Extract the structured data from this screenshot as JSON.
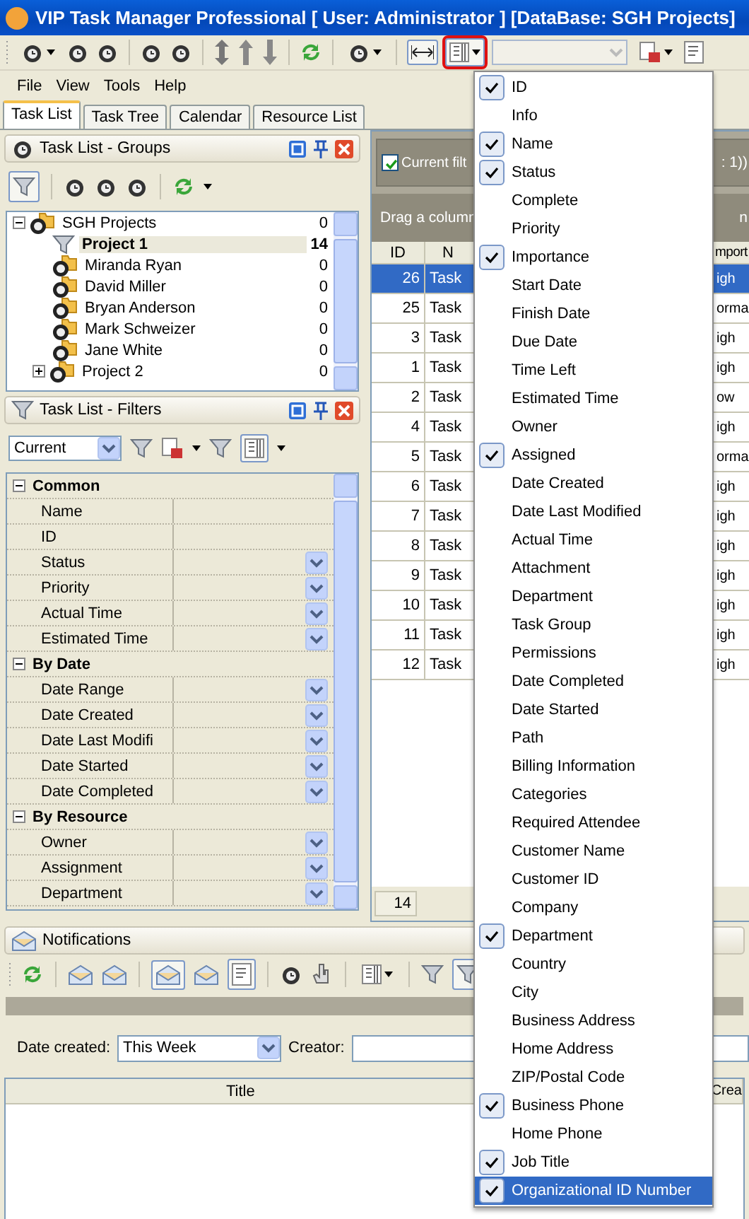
{
  "window": {
    "title": "VIP Task Manager Professional [ User: Administrator ] [DataBase: SGH Projects]"
  },
  "toolbar": {
    "column_button_highlighted": true
  },
  "menu_bar": [
    "File",
    "View",
    "Tools",
    "Help"
  ],
  "tabs": [
    {
      "label": "Task List",
      "selected": true
    },
    {
      "label": "Task Tree",
      "selected": false
    },
    {
      "label": "Calendar",
      "selected": false
    },
    {
      "label": "Resource List",
      "selected": false
    }
  ],
  "groups_panel": {
    "title": "Task List - Groups",
    "tree": [
      {
        "label": "SGH Projects",
        "count": "0",
        "expanded": true,
        "selected": false,
        "kind": "group",
        "children": [
          {
            "label": "Project 1",
            "count": "14",
            "selected": true,
            "kind": "filter"
          },
          {
            "label": "Miranda Ryan",
            "count": "0",
            "selected": false,
            "kind": "group"
          },
          {
            "label": "David Miller",
            "count": "0",
            "selected": false,
            "kind": "group"
          },
          {
            "label": "Bryan Anderson",
            "count": "0",
            "selected": false,
            "kind": "group"
          },
          {
            "label": "Mark Schweizer",
            "count": "0",
            "selected": false,
            "kind": "group"
          },
          {
            "label": "Jane White",
            "count": "0",
            "selected": false,
            "kind": "group"
          },
          {
            "label": "Project 2",
            "count": "0",
            "selected": false,
            "expanded": false,
            "kind": "group"
          }
        ]
      }
    ]
  },
  "filters_panel": {
    "title": "Task List - Filters",
    "preset": "Current",
    "sections": [
      {
        "title": "Common",
        "expanded": true,
        "fields": [
          {
            "label": "Name",
            "dropdown": false
          },
          {
            "label": "ID",
            "dropdown": false
          },
          {
            "label": "Status",
            "dropdown": true
          },
          {
            "label": "Priority",
            "dropdown": true
          },
          {
            "label": "Actual Time",
            "dropdown": true
          },
          {
            "label": "Estimated Time",
            "dropdown": true
          }
        ]
      },
      {
        "title": "By Date",
        "expanded": true,
        "fields": [
          {
            "label": "Date Range",
            "dropdown": true
          },
          {
            "label": "Date Created",
            "dropdown": true
          },
          {
            "label": "Date Last Modifi",
            "dropdown": true
          },
          {
            "label": "Date Started",
            "dropdown": true
          },
          {
            "label": "Date Completed",
            "dropdown": true
          }
        ]
      },
      {
        "title": "By Resource",
        "expanded": true,
        "fields": [
          {
            "label": "Owner",
            "dropdown": true
          },
          {
            "label": "Assignment",
            "dropdown": true
          },
          {
            "label": "Department",
            "dropdown": true
          }
        ]
      }
    ]
  },
  "task_grid": {
    "current_filter": {
      "checked": true,
      "label": "Current filt",
      "tail": ": 1))"
    },
    "group_hint": {
      "label": "Drag a column",
      "tail": "n"
    },
    "columns": [
      "ID",
      "N",
      "mport"
    ],
    "rows": [
      {
        "id": "26",
        "name": "Task",
        "column_3": "igh",
        "selected": true
      },
      {
        "id": "25",
        "name": "Task",
        "column_3": "orma",
        "selected": false
      },
      {
        "id": "3",
        "name": "Task",
        "column_3": "igh",
        "selected": false
      },
      {
        "id": "1",
        "name": "Task",
        "column_3": "igh",
        "selected": false
      },
      {
        "id": "2",
        "name": "Task",
        "column_3": "ow",
        "selected": false
      },
      {
        "id": "4",
        "name": "Task",
        "column_3": "igh",
        "selected": false
      },
      {
        "id": "5",
        "name": "Task",
        "column_3": "orma",
        "selected": false
      },
      {
        "id": "6",
        "name": "Task",
        "column_3": "igh",
        "selected": false
      },
      {
        "id": "7",
        "name": "Task",
        "column_3": "igh",
        "selected": false
      },
      {
        "id": "8",
        "name": "Task",
        "column_3": "igh",
        "selected": false
      },
      {
        "id": "9",
        "name": "Task",
        "column_3": "igh",
        "selected": false
      },
      {
        "id": "10",
        "name": "Task",
        "column_3": "igh",
        "selected": false
      },
      {
        "id": "11",
        "name": "Task",
        "column_3": "igh",
        "selected": false
      },
      {
        "id": "12",
        "name": "Task",
        "column_3": "igh",
        "selected": false
      }
    ],
    "footer_count": "14"
  },
  "notifications": {
    "title": "Notifications",
    "date_created_label": "Date created:",
    "date_created_value": "This Week",
    "creator_label": "Creator:",
    "columns": [
      "Title",
      "Crea"
    ]
  },
  "column_menu": [
    {
      "label": "ID",
      "checked": true,
      "selected": false
    },
    {
      "label": "Info",
      "checked": false,
      "selected": false
    },
    {
      "label": "Name",
      "checked": true,
      "selected": false
    },
    {
      "label": "Status",
      "checked": true,
      "selected": false
    },
    {
      "label": "Complete",
      "checked": false,
      "selected": false
    },
    {
      "label": "Priority",
      "checked": false,
      "selected": false
    },
    {
      "label": "Importance",
      "checked": true,
      "selected": false
    },
    {
      "label": "Start Date",
      "checked": false,
      "selected": false
    },
    {
      "label": "Finish Date",
      "checked": false,
      "selected": false
    },
    {
      "label": "Due Date",
      "checked": false,
      "selected": false
    },
    {
      "label": "Time Left",
      "checked": false,
      "selected": false
    },
    {
      "label": "Estimated Time",
      "checked": false,
      "selected": false
    },
    {
      "label": "Owner",
      "checked": false,
      "selected": false
    },
    {
      "label": "Assigned",
      "checked": true,
      "selected": false
    },
    {
      "label": "Date Created",
      "checked": false,
      "selected": false
    },
    {
      "label": "Date Last Modified",
      "checked": false,
      "selected": false
    },
    {
      "label": "Actual Time",
      "checked": false,
      "selected": false
    },
    {
      "label": "Attachment",
      "checked": false,
      "selected": false
    },
    {
      "label": "Department",
      "checked": false,
      "selected": false
    },
    {
      "label": "Task Group",
      "checked": false,
      "selected": false
    },
    {
      "label": "Permissions",
      "checked": false,
      "selected": false
    },
    {
      "label": "Date Completed",
      "checked": false,
      "selected": false
    },
    {
      "label": "Date Started",
      "checked": false,
      "selected": false
    },
    {
      "label": "Path",
      "checked": false,
      "selected": false
    },
    {
      "label": "Billing Information",
      "checked": false,
      "selected": false
    },
    {
      "label": "Categories",
      "checked": false,
      "selected": false
    },
    {
      "label": "Required Attendee",
      "checked": false,
      "selected": false
    },
    {
      "label": "Customer Name",
      "checked": false,
      "selected": false
    },
    {
      "label": "Customer ID",
      "checked": false,
      "selected": false
    },
    {
      "label": "Company",
      "checked": false,
      "selected": false
    },
    {
      "label": "Department",
      "checked": true,
      "selected": false
    },
    {
      "label": "Country",
      "checked": false,
      "selected": false
    },
    {
      "label": "City",
      "checked": false,
      "selected": false
    },
    {
      "label": "Business Address",
      "checked": false,
      "selected": false
    },
    {
      "label": "Home Address",
      "checked": false,
      "selected": false
    },
    {
      "label": "ZIP/Postal Code",
      "checked": false,
      "selected": false
    },
    {
      "label": "Business Phone",
      "checked": true,
      "selected": false
    },
    {
      "label": "Home Phone",
      "checked": false,
      "selected": false
    },
    {
      "label": "Job Title",
      "checked": true,
      "selected": false
    },
    {
      "label": "Organizational ID Number",
      "checked": true,
      "selected": true
    }
  ]
}
